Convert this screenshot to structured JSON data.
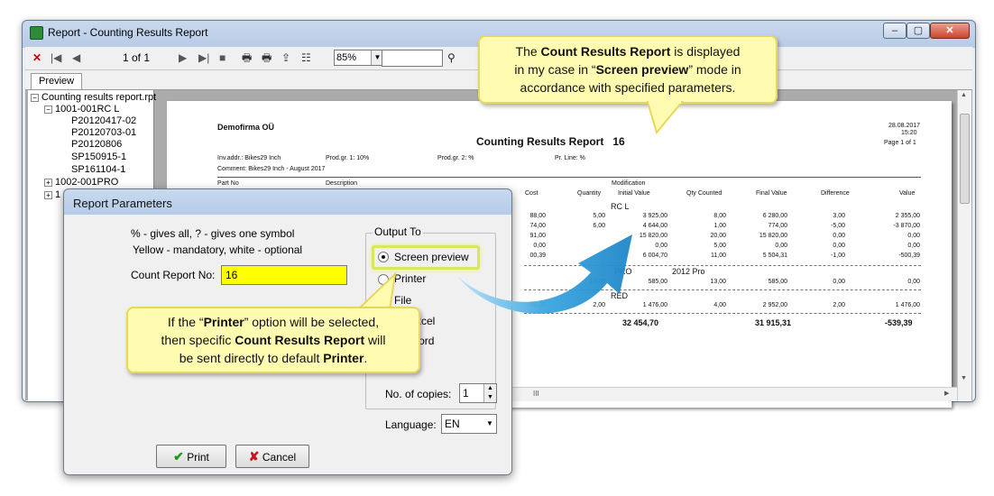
{
  "window": {
    "title": "Report - Counting Results Report",
    "page_label": "1 of 1",
    "zoom": "85%",
    "tab": "Preview",
    "btn_min": "–",
    "btn_max": "▢",
    "btn_close": "✕"
  },
  "tree": {
    "root": "Counting results report.rpt",
    "group1": "1001-001RC L",
    "items": [
      "P20120417-02",
      "P20120703-01",
      "P20120806",
      "SP150915-1",
      "SP161104-1"
    ],
    "group2": "1002-001PRO",
    "group3": "1"
  },
  "report": {
    "company": "Demofirma OÜ",
    "title": "Counting Results Report",
    "number": "16",
    "date": "28.08.2017",
    "time": "15:20",
    "page": "Page 1 of 1",
    "inv_addr": "Inv.addr.: Bikes29 Inch",
    "prod_gr1": "Prod.gr. 1: 10%",
    "prod_gr2": "Prod.gr. 2: %",
    "pr_line": "Pr. Line: %",
    "comment": "Comment: Bikes29 Inch - August 2017",
    "col_partno": "Part No",
    "col_desc": "Description",
    "col_cost": "Cost",
    "col_qty": "Quantity",
    "col_mod": "Modification",
    "col_initial": "Initial Value",
    "col_counted": "Qty Counted",
    "col_final": "Final Value",
    "col_diff": "Difference",
    "col_value": "Value",
    "group_rcl": "RC L",
    "group_pro": "PRO",
    "group_pro_name": "2012 Pro",
    "group_red": "RED",
    "rows_rcl": [
      [
        "88,00",
        "5,00",
        "3 925,00",
        "8,00",
        "6 280,00",
        "3,00",
        "2 355,00"
      ],
      [
        "74,00",
        "6,00",
        "4 644,00",
        "1,00",
        "774,00",
        "-5,00",
        "-3 870,00"
      ],
      [
        "91,00",
        "",
        "15 820,00",
        "20,00",
        "15 820,00",
        "0,00",
        "0,00"
      ],
      [
        "0,00",
        "",
        "0,00",
        "5,00",
        "0,00",
        "0,00",
        "0,00"
      ],
      [
        "00,39",
        "",
        "6 004,70",
        "11,00",
        "5 504,31",
        "-1,00",
        "-500,39"
      ]
    ],
    "row_pro": [
      "13,00",
      "585,00",
      "13,00",
      "585,00",
      "0,00",
      "0,00"
    ],
    "row_red": [
      "38,00",
      "2,00",
      "1 476,00",
      "4,00",
      "2 952,00",
      "2,00",
      "1 476,00"
    ],
    "total_initial": "32 454,70",
    "total_final": "31 915,31",
    "total_value": "-539,39",
    "hscroll_marker": "III"
  },
  "dialog": {
    "title": "Report Parameters",
    "hint1": "% - gives all, ? - gives one symbol",
    "hint2": "Yellow - mandatory, white - optional",
    "count_label": "Count Report No:",
    "count_value": "16",
    "output_legend": "Output To",
    "opt_screen": "Screen preview",
    "opt_printer": "Printer",
    "opt_file": "File",
    "opt_excel": "Excel",
    "opt_word": "Word",
    "copies_label": "No. of copies:",
    "copies_value": "1",
    "language_label": "Language:",
    "language_value": "EN",
    "print_label": "Print",
    "cancel_label": "Cancel"
  },
  "callout_top": {
    "l1a": "The ",
    "l1b": "Count Results Report",
    "l1c": " is displayed",
    "l2a": "in my case in “",
    "l2b": "Screen preview",
    "l2c": "” mode in",
    "l3": "accordance with specified parameters."
  },
  "callout_bottom": {
    "l1a": "If the “",
    "l1b": "Printer",
    "l1c": "” option will be selected,",
    "l2a": "then specific ",
    "l2b": "Count Results Report",
    "l2c": " will",
    "l3a": "be sent directly to default ",
    "l3b": "Printer",
    "l3c": "."
  },
  "colors": {
    "mandatory_field": "#ffff00",
    "callout_bg": "#fffbb0",
    "arrow": "#3aa6e0"
  }
}
